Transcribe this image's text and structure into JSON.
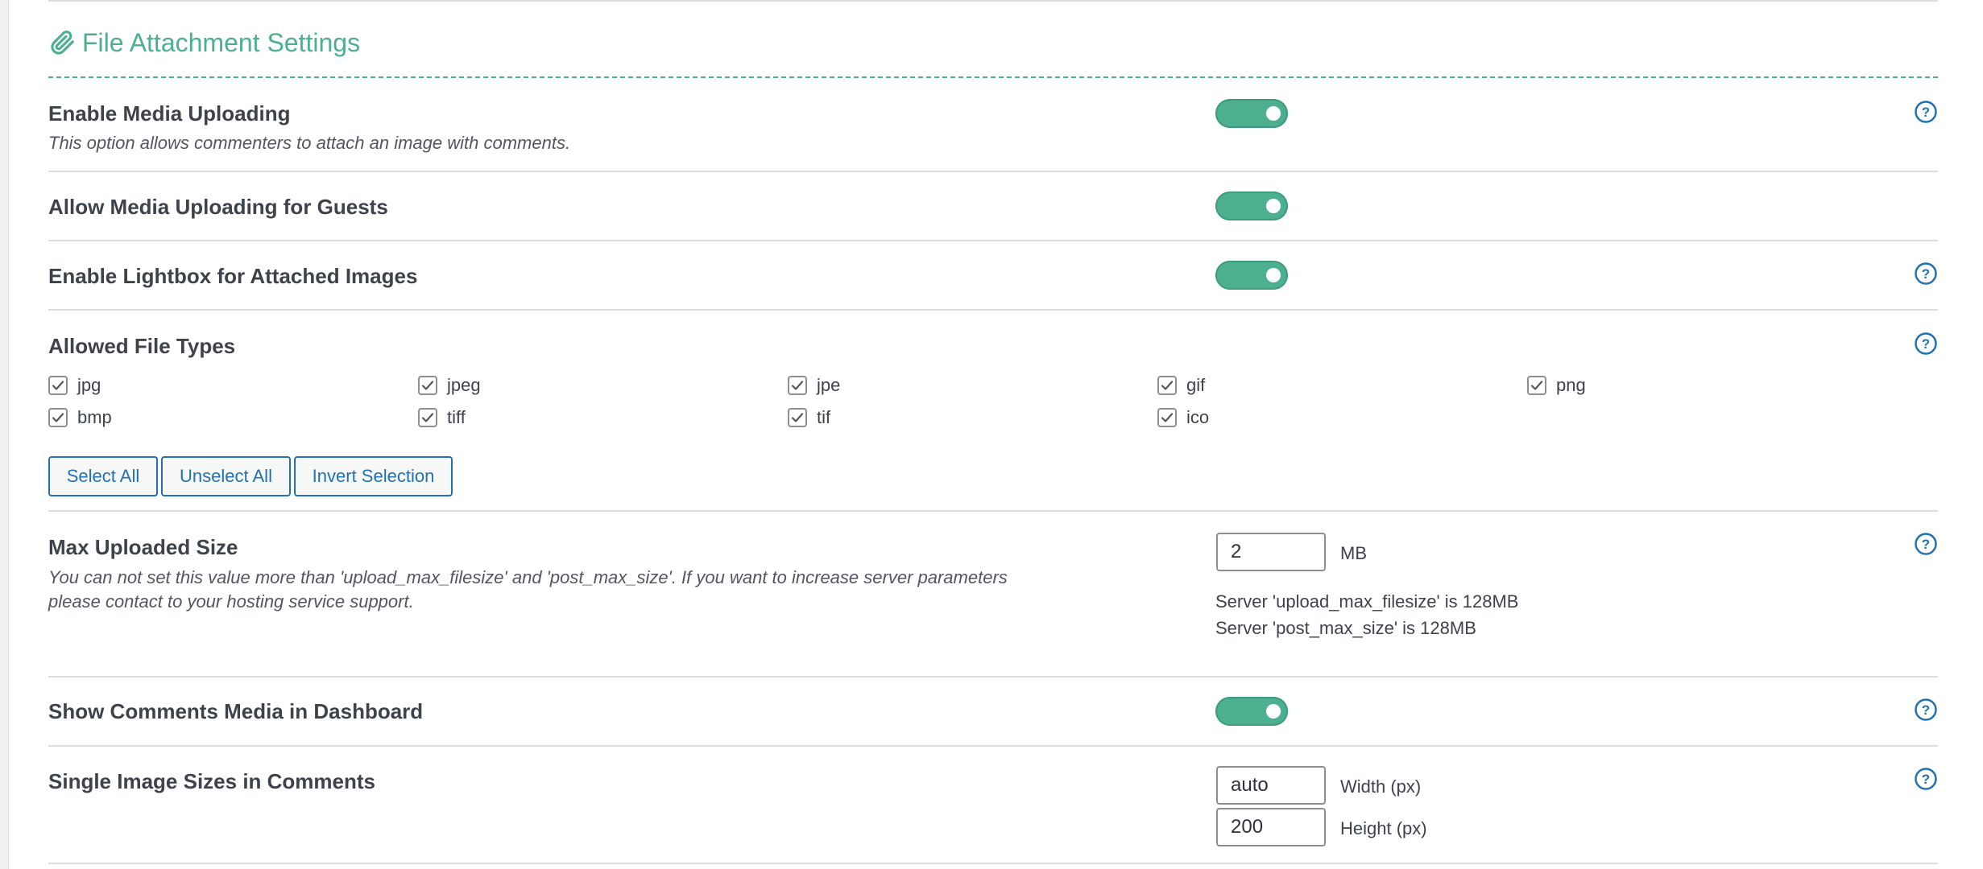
{
  "section": {
    "title": "File Attachment Settings",
    "icon": "paperclip-icon"
  },
  "colors": {
    "accent": "#4caf90",
    "link": "#2271b1",
    "help": "#2271b1"
  },
  "settings": {
    "media_uploading": {
      "label": "Enable Media Uploading",
      "description": "This option allows commenters to attach an image with comments.",
      "enabled": true
    },
    "guest_uploading": {
      "label": "Allow Media Uploading for Guests",
      "enabled": true
    },
    "lightbox": {
      "label": "Enable Lightbox for Attached Images",
      "enabled": true
    },
    "file_types": {
      "label": "Allowed File Types",
      "types": [
        {
          "name": "jpg",
          "checked": true
        },
        {
          "name": "jpeg",
          "checked": true
        },
        {
          "name": "jpe",
          "checked": true
        },
        {
          "name": "gif",
          "checked": true
        },
        {
          "name": "png",
          "checked": true
        },
        {
          "name": "bmp",
          "checked": true
        },
        {
          "name": "tiff",
          "checked": true
        },
        {
          "name": "tif",
          "checked": true
        },
        {
          "name": "ico",
          "checked": true
        }
      ],
      "buttons": {
        "select_all": "Select All",
        "unselect_all": "Unselect All",
        "invert": "Invert Selection"
      }
    },
    "max_size": {
      "label": "Max Uploaded Size",
      "description_line1": "You can not set this value more than 'upload_max_filesize' and 'post_max_size'. If you want to increase server parameters",
      "description_line2": "please contact to your hosting service support.",
      "value": "2",
      "unit": "MB",
      "server_upload": "Server 'upload_max_filesize' is 128MB",
      "server_post": "Server 'post_max_size' is 128MB"
    },
    "dashboard_media": {
      "label": "Show Comments Media in Dashboard",
      "enabled": true
    },
    "image_sizes": {
      "label": "Single Image Sizes in Comments",
      "width_value": "auto",
      "width_label": "Width (px)",
      "height_value": "200",
      "height_label": "Height (px)"
    }
  }
}
